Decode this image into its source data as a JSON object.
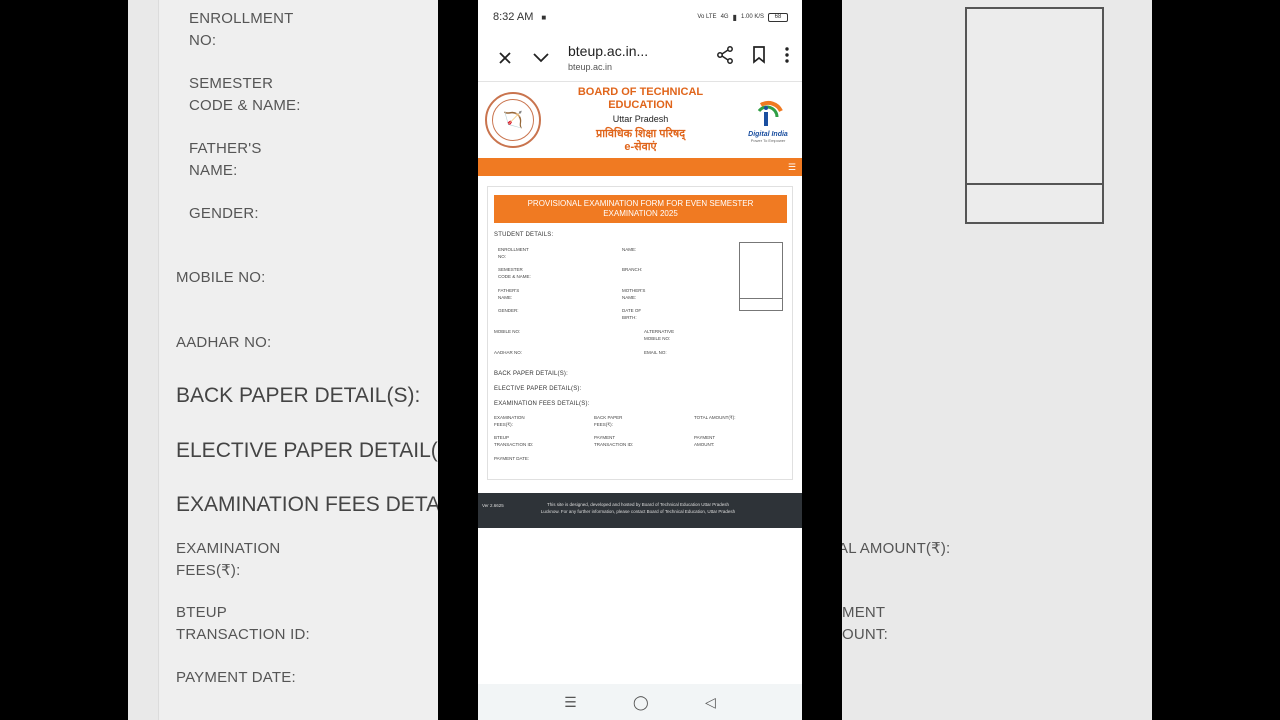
{
  "background": {
    "left_labels": [
      {
        "text": "ENROLLMENT",
        "text2": "NO:"
      },
      {
        "text": "SEMESTER",
        "text2": "CODE & NAME:"
      },
      {
        "text": "FATHER'S",
        "text2": "NAME:"
      },
      {
        "text": "GENDER:"
      }
    ],
    "mobile_no": "MOBILE NO:",
    "aadhar_no": "AADHAR NO:",
    "back_paper": "BACK PAPER DETAIL(S):",
    "elective_paper": "ELECTIVE PAPER DETAIL(S):",
    "exam_fees": "EXAMINATION FEES DETAIL",
    "exam_fees_label_1": "EXAMINATION",
    "exam_fees_label_2": "FEES(₹):",
    "bteup_label_1": "BTEUP",
    "bteup_label_2": "TRANSACTION ID:",
    "payment_date": "PAYMENT DATE:",
    "right_total": "AL AMOUNT(₹):",
    "right_ment": "MENT",
    "right_ount": "OUNT:"
  },
  "status_bar": {
    "time": "8:32 AM",
    "network": "Vo LTE",
    "signal": "4G",
    "speed": "1.00 K/S",
    "battery": "68"
  },
  "browser": {
    "title": "bteup.ac.in...",
    "url": "bteup.ac.in"
  },
  "site": {
    "board_line1": "BOARD OF TECHNICAL",
    "board_line2": "EDUCATION",
    "state": "Uttar Pradesh",
    "hindi_line1": "प्राविधिक शिक्षा परिषद्",
    "hindi_line2": "e-सेवाएं",
    "digital_india": "Digital India",
    "digital_india_tag": "Power To Empower"
  },
  "form": {
    "banner_line1": "PROVISIONAL EXAMINATION FORM FOR EVEN SEMESTER",
    "banner_line2": "EXAMINATION 2025",
    "student_details": "STUDENT DETAILS:",
    "fields": {
      "enrollment_1": "ENROLLMENT",
      "enrollment_2": "NO:",
      "name": "NAME:",
      "semester_1": "SEMESTER",
      "semester_2": "CODE & NAME:",
      "branch": "BRANCH:",
      "father_1": "FATHER'S",
      "father_2": "NAME:",
      "mother_1": "MOTHER'S",
      "mother_2": "NAME:",
      "gender": "GENDER:",
      "dob_1": "DATE OF",
      "dob_2": "BIRTH:",
      "mobile": "MOBILE NO:",
      "alt_mobile_1": "ALTERNATIVE",
      "alt_mobile_2": "MOBILE NO:",
      "aadhar": "AADHAR NO:",
      "email": "EMAIL NO:"
    },
    "back_paper": "BACK PAPER DETAIL(S):",
    "elective_paper": "ELECTIVE PAPER DETAIL(S):",
    "exam_fees_title": "EXAMINATION FEES DETAIL(S):",
    "fees": {
      "exam_fees_1": "EXAMINATION",
      "exam_fees_2": "FEES(₹):",
      "back_fees_1": "BACK PAPER",
      "back_fees_2": "FEES(₹):",
      "total": "TOTAL AMOUNT(₹):",
      "bteup_1": "BTEUP",
      "bteup_2": "TRANSACTION ID:",
      "payment_txn_1": "PAYMENT",
      "payment_txn_2": "TRANSACTION ID:",
      "payment_amt_1": "PAYMENT",
      "payment_amt_2": "AMOUNT:",
      "payment_date": "PAYMENT DATE:"
    }
  },
  "footer": {
    "version": "Ver 2.6625",
    "text": "This site is designed, developed and hosted by Board of Technical Education Uttar Pradesh Lucknow. For any further information, please contact Board of Technical Education, Uttar Pradesh"
  },
  "colors": {
    "accent": "#f07a22",
    "title": "#e0651b",
    "footer": "#2e3338"
  }
}
